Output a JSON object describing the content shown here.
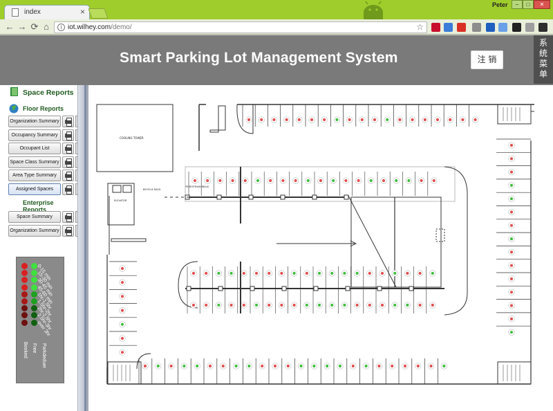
{
  "browser": {
    "tab_title": "index",
    "tab_close": "×",
    "url_host": "iot.wilhey.com",
    "url_path": "/demo/",
    "user_name": "Peter",
    "btn_min": "–",
    "btn_max": "□",
    "btn_close": "✕",
    "nav_back": "←",
    "nav_forward": "→",
    "nav_reload": "⟳",
    "nav_home": "⌂",
    "extensions": [
      {
        "name": "abp-icon",
        "color": "#c8102e"
      },
      {
        "name": "weather-icon",
        "color": "#3b7dd8"
      },
      {
        "name": "red-ext-icon",
        "color": "#d93025"
      },
      {
        "name": "grey-ext-icon",
        "color": "#8d8d8d"
      },
      {
        "name": "blue-ext-icon",
        "color": "#1f5fbf"
      },
      {
        "name": "translate-ext-icon",
        "color": "#6aa0e8"
      },
      {
        "name": "circle-ext-icon",
        "color": "#222222"
      },
      {
        "name": "doc-ext-icon",
        "color": "#9e9e9e"
      },
      {
        "name": "evernote-icon",
        "color": "#2e2e2e"
      },
      {
        "name": "menu-icon",
        "color": "#555555"
      }
    ]
  },
  "header": {
    "title": "Smart Parking Lot Management System",
    "logout_label": "注 销",
    "system_menu_label": "系统菜单"
  },
  "sidebar": {
    "space_reports_label": "Space Reports",
    "floor_reports_label": "Floor Reports",
    "floor_buttons": [
      "Organization Summary",
      "Occupancy Summary",
      "Occupant List",
      "Space Class Summary",
      "Area Type Summary",
      "Assigned Spaces"
    ],
    "enterprise_reports_label": "Enterprise Reports",
    "enterprise_buttons": [
      "Space Summary",
      "Organization Summary"
    ]
  },
  "legend": {
    "rows": [
      "0-15 min",
      "15-30 min",
      "30-45 min",
      "45-60 min",
      "1hr-1.5hr",
      "1.5hr-2hr",
      "2hr-2.5hr",
      "2.5hr-3hr",
      "over 3hr"
    ],
    "col_left_label": "Booked",
    "col_mid_label": "Free",
    "col_right_label": "Parkdeduer",
    "colors": {
      "booked": "#d92020",
      "free_light": "#3fe03f",
      "free_dark": "#106010"
    }
  },
  "plan": {
    "cooling_tower_label": "COOLING TOWER",
    "elevator_label": "ELEVATOR LOBBY",
    "bicycle_label": "BICYCLE RACK",
    "pedestrian_label": "PEDESTRIAN WALK",
    "colors": {
      "occupied": "#e05050",
      "free": "#40c040",
      "line": "#333333"
    }
  }
}
